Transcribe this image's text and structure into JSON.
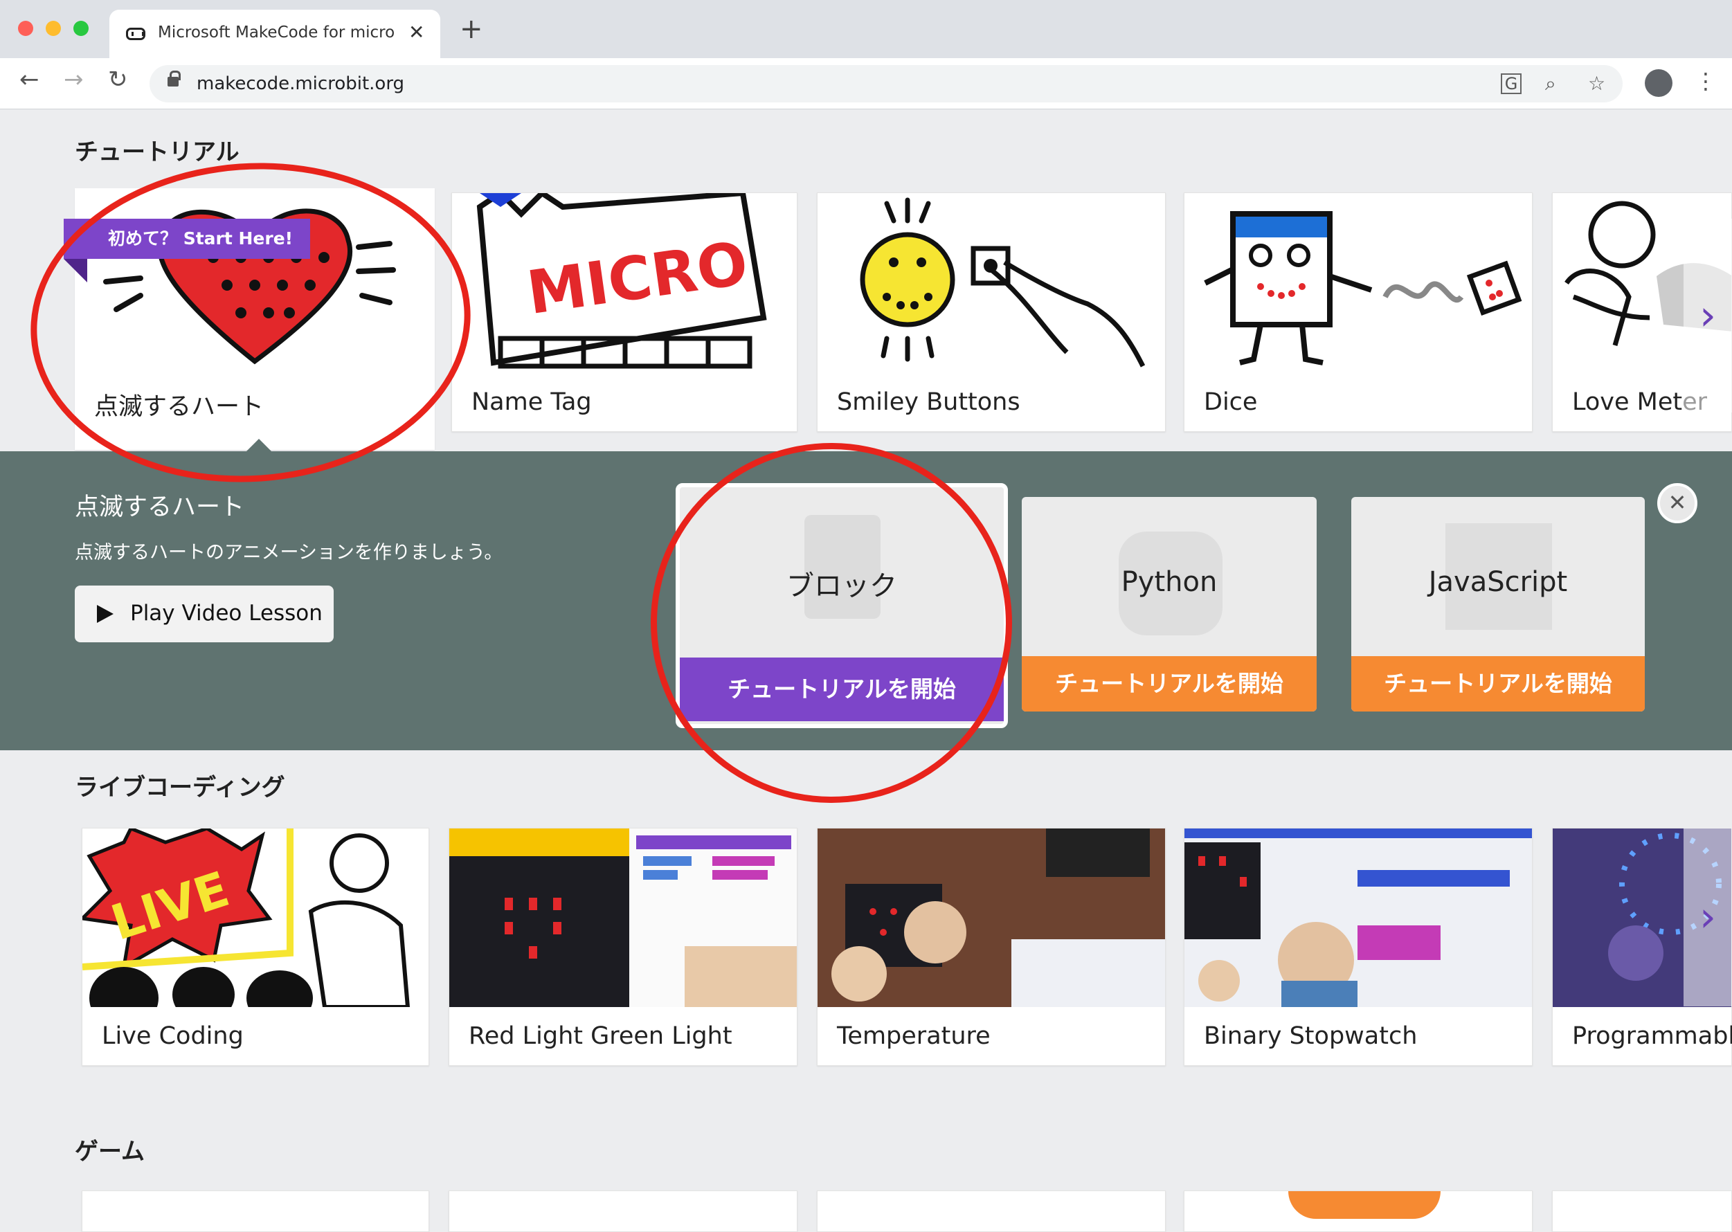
{
  "browser": {
    "tab_title": "Microsoft MakeCode for micro",
    "tab_close": "✕",
    "new_tab": "+",
    "url": "makecode.microbit.org"
  },
  "sections": {
    "tutorials": "チュートリアル",
    "live_coding": "ライブコーディング",
    "games": "ゲーム"
  },
  "tutorial_cards": [
    {
      "label": "点滅するハート"
    },
    {
      "label": "Name Tag"
    },
    {
      "label": "Smiley Buttons"
    },
    {
      "label": "Dice"
    },
    {
      "label": "Love Meter"
    }
  ],
  "badge": "初めて？ Start Here!",
  "detail": {
    "title": "点滅するハート",
    "description": "点滅するハートのアニメーションを作りましょう。",
    "play_video": "Play Video Lesson",
    "close": "✕",
    "languages": [
      {
        "name": "ブロック",
        "start": "チュートリアルを開始",
        "color": "#7d45c9"
      },
      {
        "name": "Python",
        "start": "チュートリアルを開始",
        "color": "#f68a32"
      },
      {
        "name": "JavaScript",
        "start": "チュートリアルを開始",
        "color": "#f68a32"
      }
    ]
  },
  "live_cards": [
    {
      "label": "Live Coding"
    },
    {
      "label": "Red Light Green Light"
    },
    {
      "label": "Temperature"
    },
    {
      "label": "Binary Stopwatch"
    },
    {
      "label": "Programmable"
    }
  ],
  "thumb_text": {
    "micro": "MICRO",
    "live": "LIVE"
  },
  "colors": {
    "accent_purple": "#7d45c9",
    "accent_orange": "#f68a32",
    "panel": "#5f7370",
    "annotation_red": "#e8231b"
  }
}
